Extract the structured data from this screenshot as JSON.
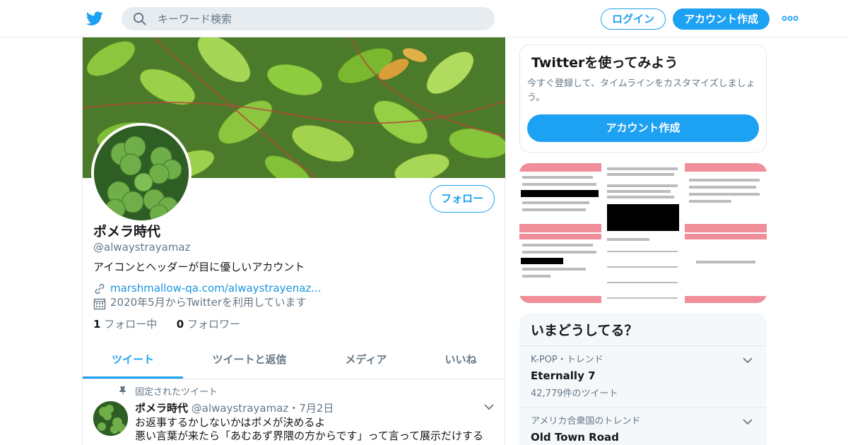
{
  "colors": {
    "accent": "#1da1f2",
    "link": "#1b95e0",
    "muted": "#657786",
    "pink_band": "#f08f9a"
  },
  "topbar": {
    "logo_icon": "twitter-bird-icon",
    "search": {
      "placeholder": "キーワード検索"
    },
    "login_label": "ログイン",
    "signup_label": "アカウント作成",
    "more_icon": "more-dots-icon"
  },
  "profile": {
    "follow_label": "フォロー",
    "name": "ポメラ時代",
    "handle": "@alwaystrayamaz",
    "bio": "アイコンとヘッダーが目に優しいアカウント",
    "link_text": "marshmallow-qa.com/alwaystrayenaz...",
    "joined": "2020年5月からTwitterを利用しています",
    "following_count": "1",
    "following_label": "フォロー中",
    "followers_count": "0",
    "followers_label": "フォロワー"
  },
  "tabs": [
    {
      "label": "ツイート"
    },
    {
      "label": "ツイートと返信"
    },
    {
      "label": "メディア"
    },
    {
      "label": "いいね"
    }
  ],
  "tweet": {
    "pinned_label": "固定されたツイート",
    "name": "ポメラ時代",
    "handle": "@alwaystrayamaz",
    "dot": "・",
    "date": "7月2日",
    "line1": "お返事するかしないかはポメが決めるよ",
    "line2": "悪い言葉が来たら「あむあず界隈の方からです」って言って展示だけする"
  },
  "signup_card": {
    "title": "Twitterを使ってみよう",
    "desc": "今すぐ登録して、タイムラインをカスタマイズしましょう。",
    "button": "アカウント作成"
  },
  "trends": {
    "title": "いまどうしてる？",
    "items": [
      {
        "context": "K-POP・トレンド",
        "name": "Eternally 7",
        "count": "42,779件のツイート"
      },
      {
        "context": "アメリカ合衆国のトレンド",
        "name": "Old Town Road"
      }
    ]
  }
}
